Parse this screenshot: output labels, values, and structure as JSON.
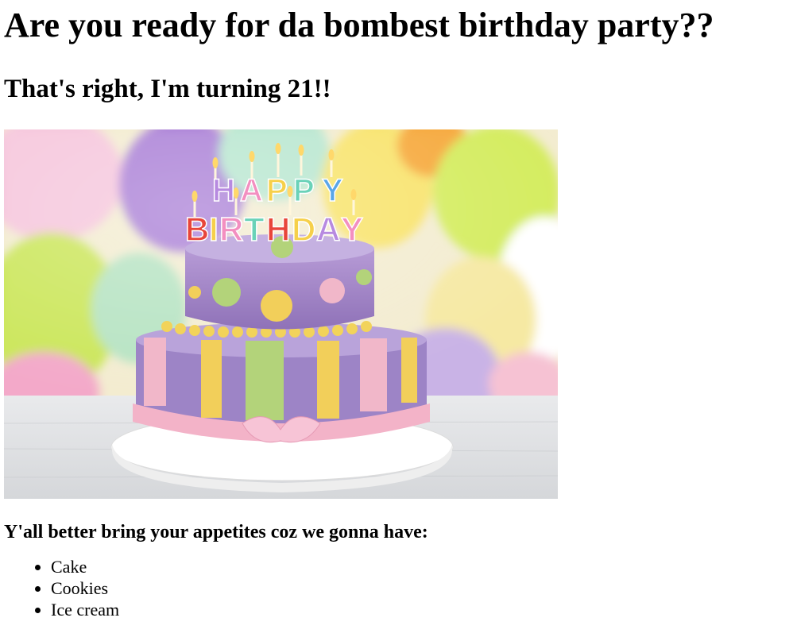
{
  "page": {
    "heading": "Are you ready for da bombest birthday party??",
    "subheading": "That's right, I'm turning 21!!",
    "image": {
      "name": "birthday-cake-photo",
      "cake_text_top": "HAPPY",
      "cake_text_bottom": "BIRTHDAY"
    },
    "food_intro": "Y'all better bring your appetites coz we gonna have:",
    "food_items": [
      "Cake",
      "Cookies",
      "Ice cream"
    ]
  }
}
